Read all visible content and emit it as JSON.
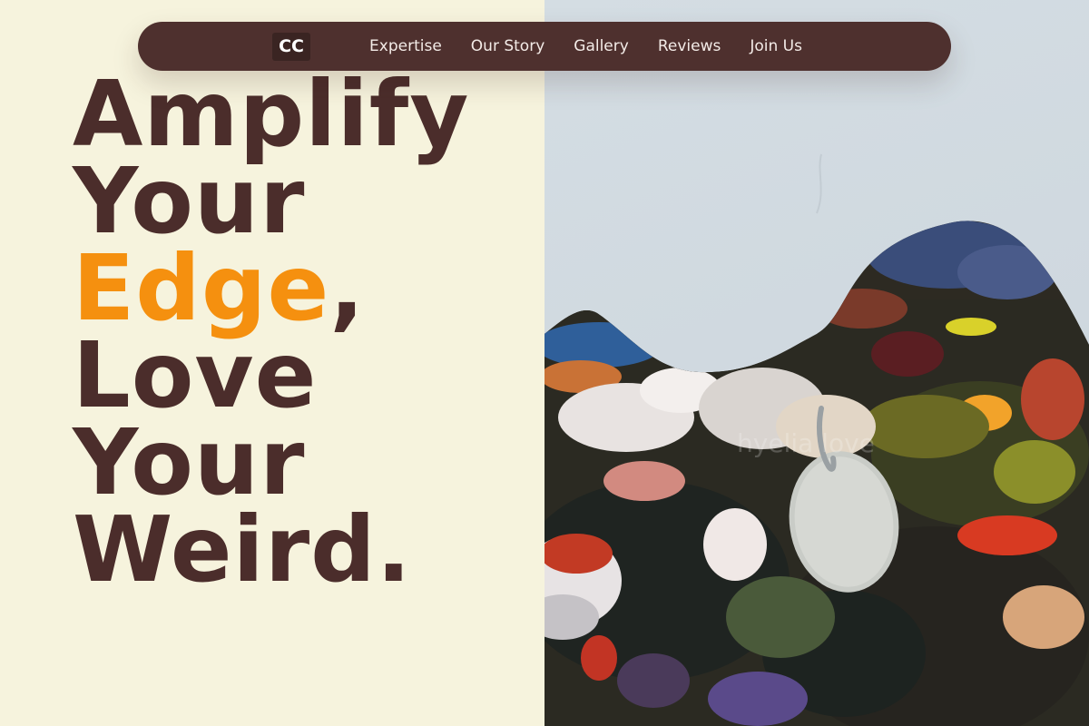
{
  "nav": {
    "logo": "CC",
    "links": [
      "Expertise",
      "Our Story",
      "Gallery",
      "Reviews",
      "Join Us"
    ]
  },
  "hero": {
    "line1": "Amplify",
    "line2": "Your",
    "line3_accent": "Edge",
    "line3_rest": ",",
    "line4": "Love",
    "line5": "Your",
    "line6": "Weird."
  },
  "image": {
    "watermark": "hyelia love"
  },
  "colors": {
    "background": "#f6f3dd",
    "nav_bg": "#4e302e",
    "heading": "#4b2d2b",
    "accent": "#f5900f"
  }
}
